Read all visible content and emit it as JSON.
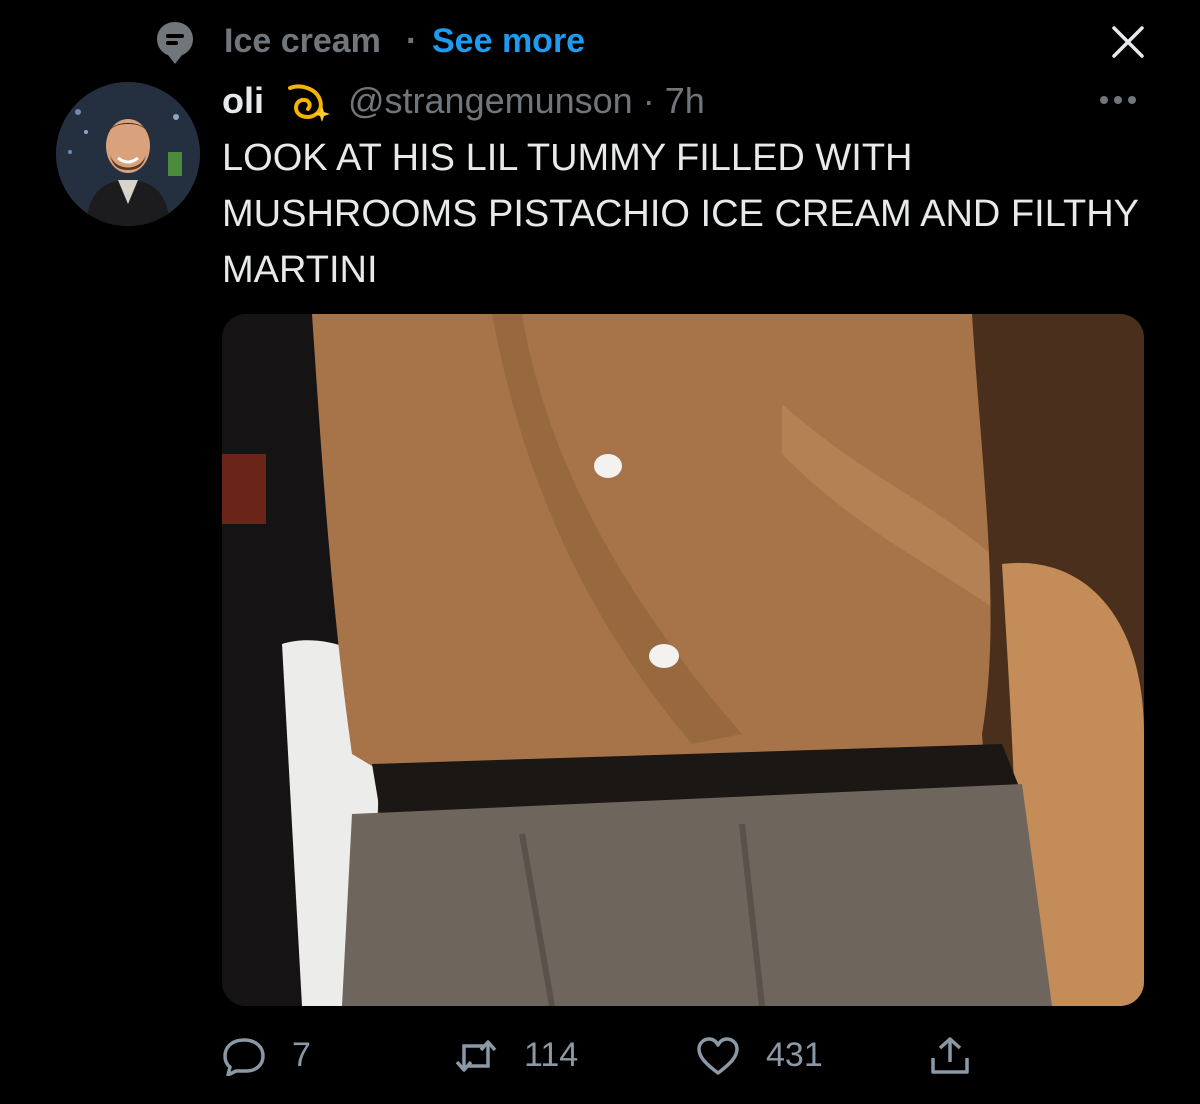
{
  "topic": {
    "icon": "topic-icon",
    "label": "Ice cream",
    "separator": "·",
    "see_more": "See more",
    "close_icon": "close-icon"
  },
  "tweet": {
    "avatar": "avatar",
    "display_name": "oli",
    "name_emoji_icon": "dizzy-comet-icon",
    "handle_time": "@strangemunson · 7h",
    "more_icon": "more-icon",
    "text": "LOOK AT HIS LIL TUMMY FILLED WITH MUSHROOMS PISTACHIO ICE CREAM AND FILTHY MARTINI",
    "media": "photo"
  },
  "actions": {
    "reply_count": "7",
    "retweet_count": "114",
    "like_count": "431"
  },
  "colors": {
    "background": "#000000",
    "text_primary": "#e7e9ea",
    "text_secondary": "#71767b",
    "link": "#1d9bf0"
  }
}
